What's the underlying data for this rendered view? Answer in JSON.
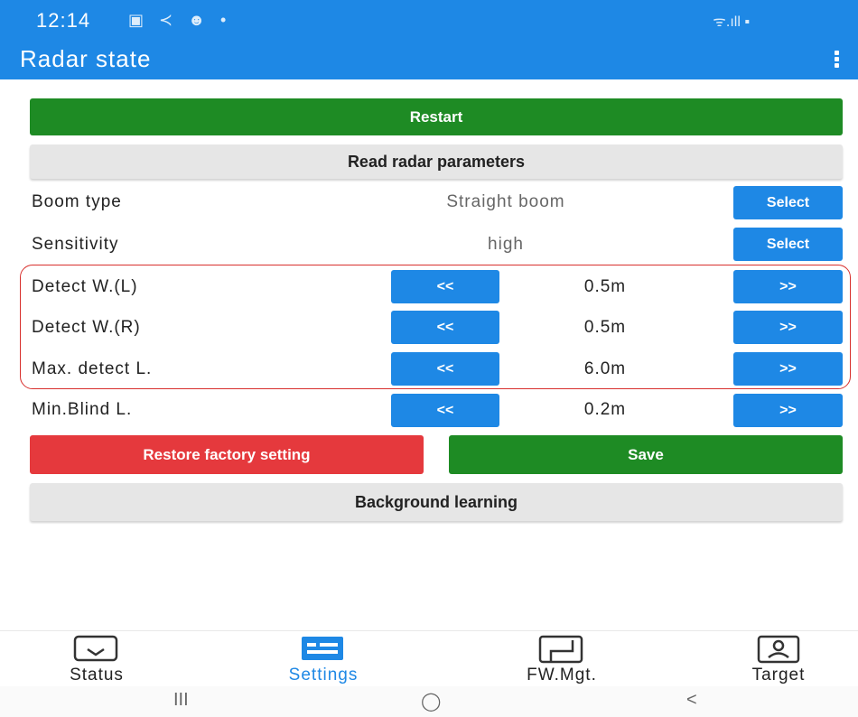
{
  "status_bar": {
    "time": "12:14",
    "left_icons": "▣ ≺ ☻ •",
    "right_icons": "ᯤ.ıll ▪"
  },
  "app_bar": {
    "title": "Radar state"
  },
  "actions": {
    "restart": "Restart",
    "read_params": "Read radar parameters",
    "restore_factory": "Restore factory setting",
    "save": "Save",
    "background_learning": "Background learning"
  },
  "settings": {
    "boom_type": {
      "label": "Boom type",
      "value": "Straight boom",
      "button": "Select"
    },
    "sensitivity": {
      "label": "Sensitivity",
      "value": "high",
      "button": "Select"
    },
    "steppers": [
      {
        "label": "Detect W.(L)",
        "value": "0.5m",
        "dec": "<<",
        "inc": ">>"
      },
      {
        "label": "Detect W.(R)",
        "value": "0.5m",
        "dec": "<<",
        "inc": ">>"
      },
      {
        "label": "Max. detect L.",
        "value": "6.0m",
        "dec": "<<",
        "inc": ">>"
      },
      {
        "label": "Min.Blind L.",
        "value": "0.2m",
        "dec": "<<",
        "inc": ">>"
      }
    ]
  },
  "bottom_nav": [
    {
      "label": "Status",
      "icon": "status-icon",
      "active": false
    },
    {
      "label": "Settings",
      "icon": "settings-icon",
      "active": true
    },
    {
      "label": "FW.Mgt.",
      "icon": "firmware-icon",
      "active": false
    },
    {
      "label": "Target",
      "icon": "target-icon",
      "active": false
    }
  ],
  "system_nav": {
    "recents": "III",
    "home": "◯",
    "back": "<"
  },
  "colors": {
    "primary": "#1e88e5",
    "green": "#1e8b24",
    "red": "#e5393d",
    "highlight": "#d8302d"
  }
}
